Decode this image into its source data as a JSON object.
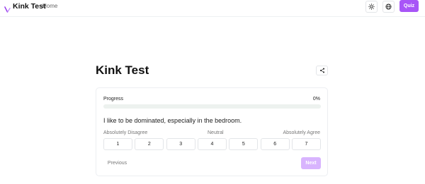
{
  "header": {
    "brand_name": "Kink Test",
    "brand_icon": "whip-icon",
    "nav_home": "Home",
    "theme_icon": "sun-icon",
    "language_icon": "globe-icon",
    "quiz_label": "Quiz"
  },
  "main": {
    "title": "Kink Test",
    "share_icon": "share-icon"
  },
  "card": {
    "progress_label": "Progress",
    "progress_value": "0%",
    "progress_fraction": 0,
    "question": "I like to be dominated, especially in the bedroom.",
    "scale": {
      "left": "Absolutely Disagree",
      "middle": "Neutral",
      "right": "Absolutely Agree"
    },
    "options": [
      "1",
      "2",
      "3",
      "4",
      "5",
      "6",
      "7"
    ],
    "previous_label": "Previous",
    "next_label": "Next"
  },
  "colors": {
    "accent": "#a855f7",
    "accent_disabled": "#d8b4fe",
    "progress_track": "#edf2ef"
  }
}
